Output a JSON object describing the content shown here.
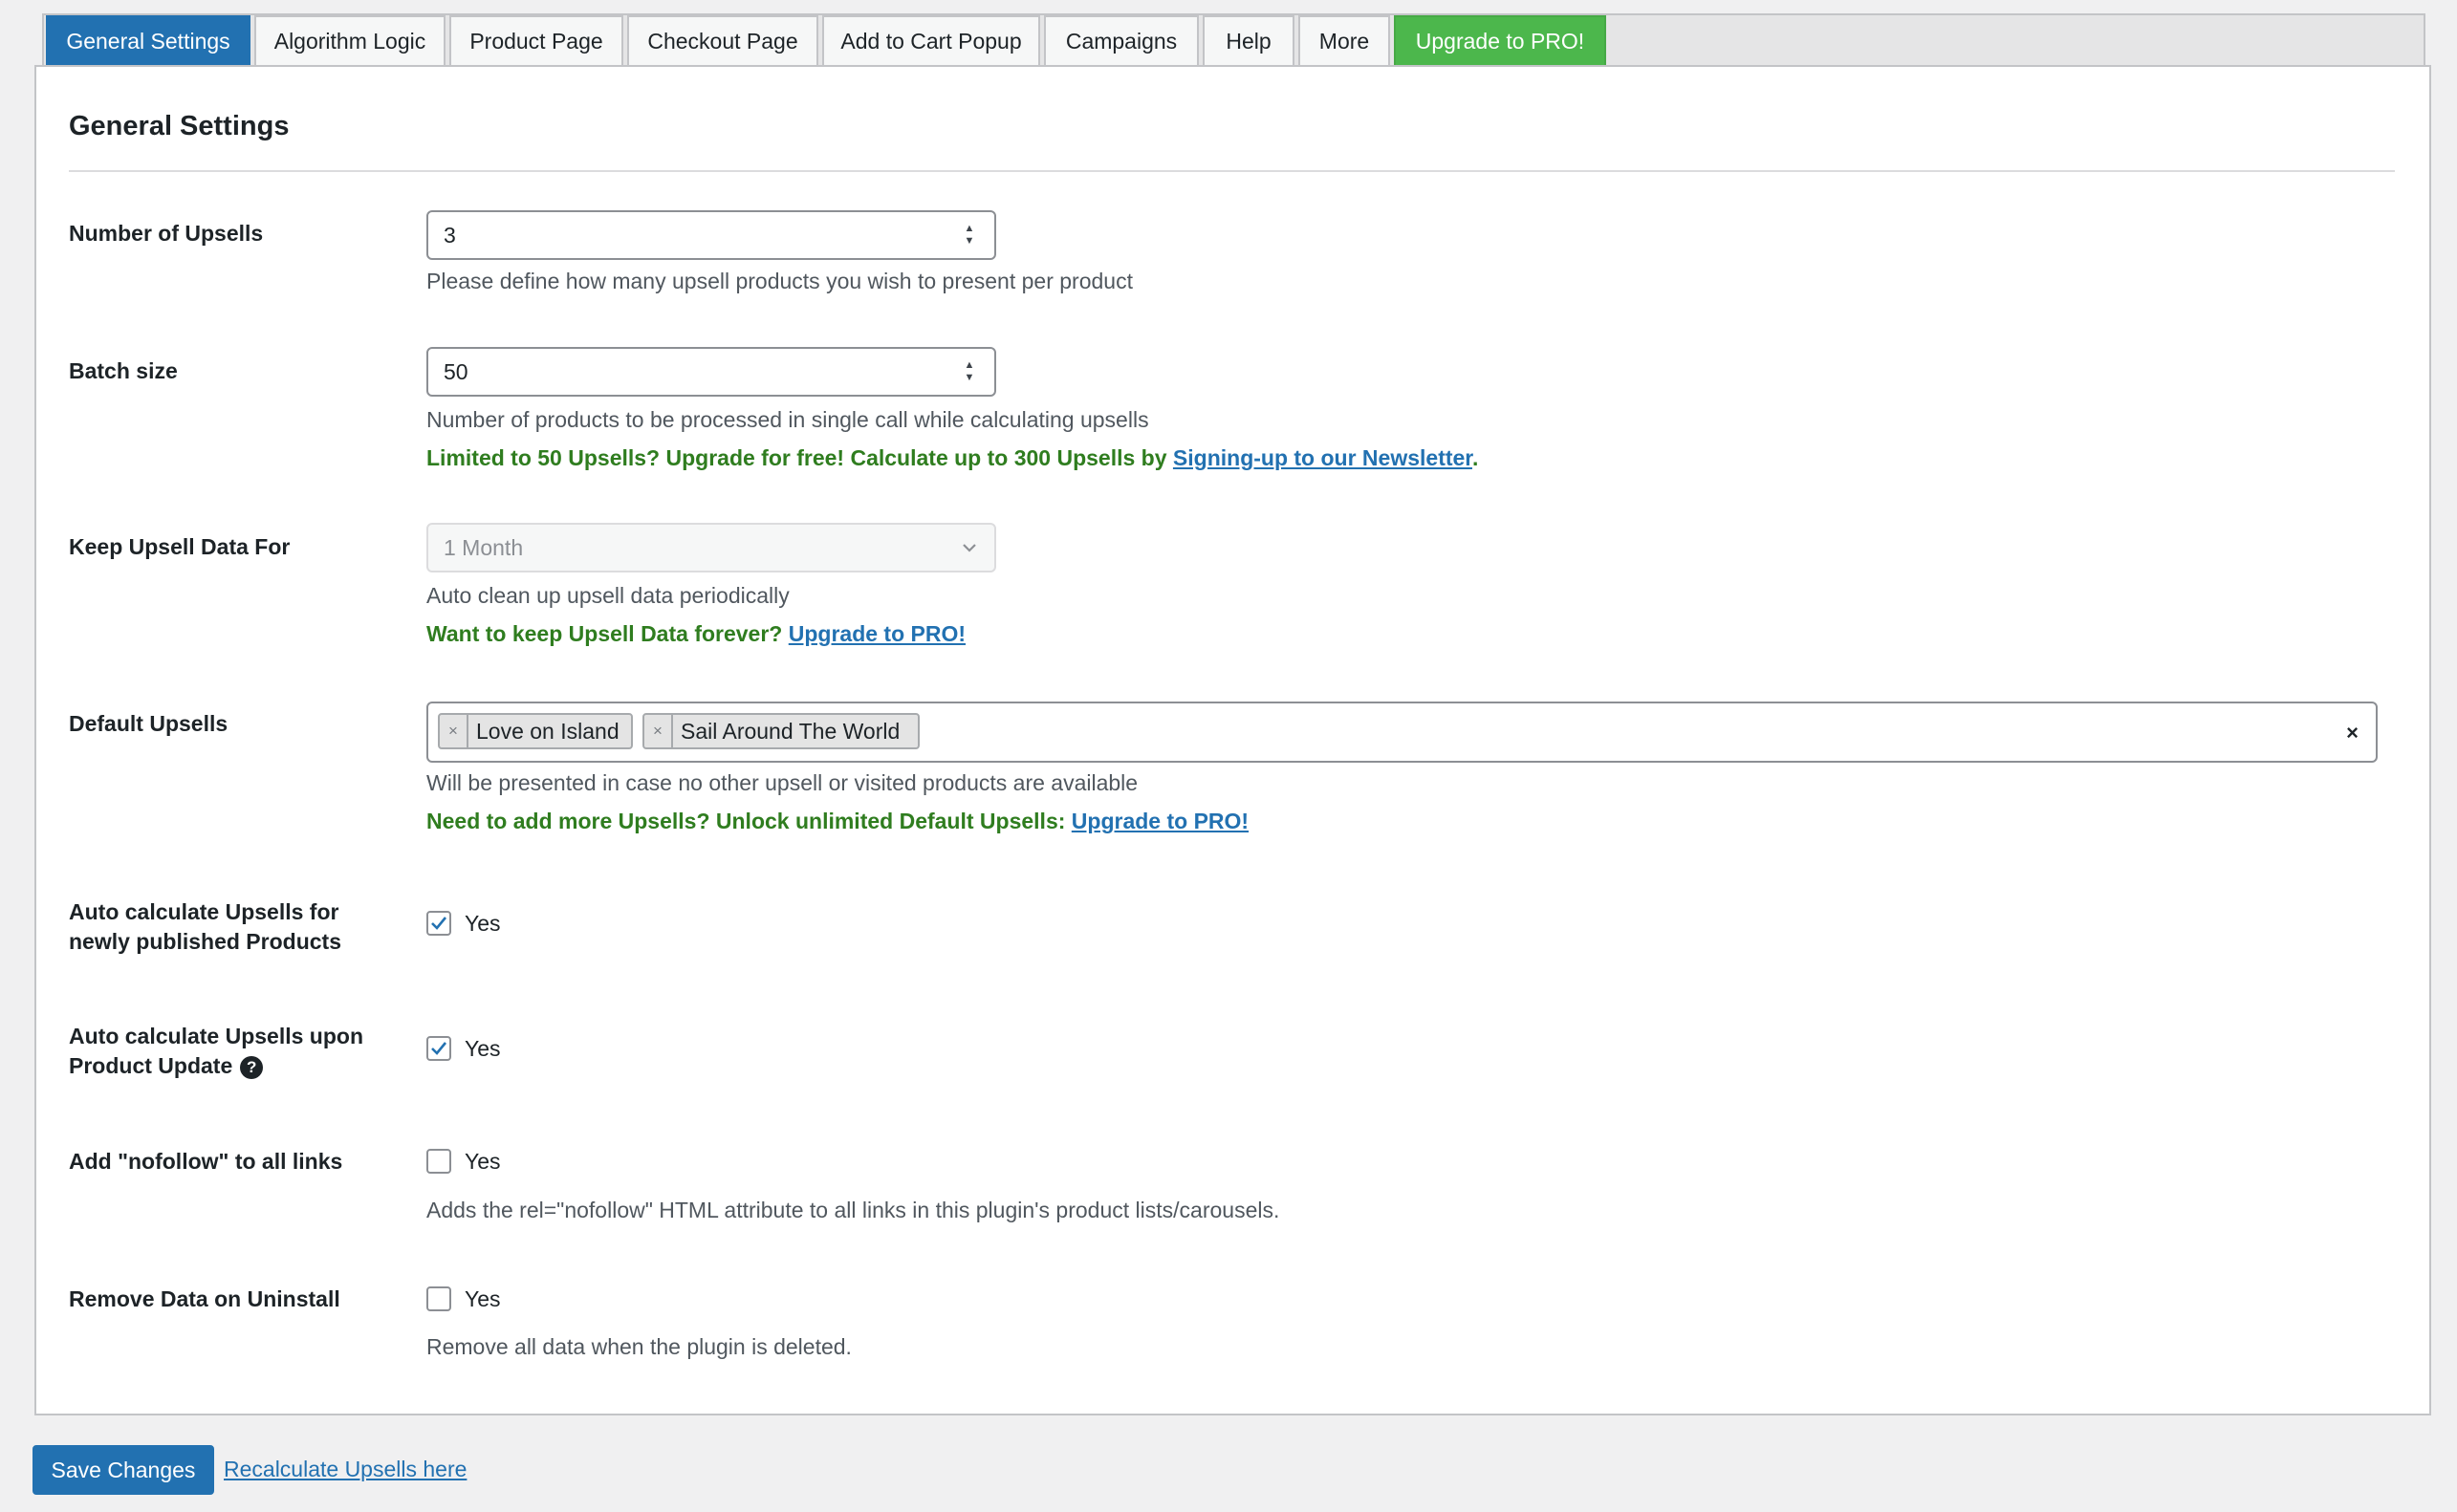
{
  "tabs": [
    {
      "label": "General Settings",
      "active": true
    },
    {
      "label": "Algorithm Logic"
    },
    {
      "label": "Product Page"
    },
    {
      "label": "Checkout Page"
    },
    {
      "label": "Add to Cart Popup"
    },
    {
      "label": "Campaigns"
    },
    {
      "label": "Help"
    },
    {
      "label": "More"
    },
    {
      "label": "Upgrade to PRO!",
      "highlight": true
    }
  ],
  "section_title": "General Settings",
  "fields": {
    "num_upsells": {
      "label": "Number of Upsells",
      "value": "3",
      "desc": "Please define how many upsell products you wish to present per product"
    },
    "batch_size": {
      "label": "Batch size",
      "value": "50",
      "desc": "Number of products to be processed in single call while calculating upsells",
      "promo_text": "Limited to 50 Upsells? Upgrade for free! Calculate up to 300 Upsells by ",
      "promo_link": "Signing-up to our Newsletter",
      "promo_suffix": "."
    },
    "keep_data": {
      "label": "Keep Upsell Data For",
      "value": "1 Month",
      "desc": "Auto clean up upsell data periodically",
      "promo_text": "Want to keep Upsell Data forever? ",
      "promo_link": "Upgrade to PRO!"
    },
    "default_upsells": {
      "label": "Default Upsells",
      "tokens": [
        "Love on Island",
        "Sail Around The World"
      ],
      "clear_symbol": "×",
      "token_remove_symbol": "×",
      "desc": "Will be presented in case no other upsell or visited products are available",
      "promo_text": "Need to add more Upsells? Unlock unlimited Default Upsells: ",
      "promo_link": "Upgrade to PRO!"
    },
    "auto_new": {
      "label_line1": "Auto calculate Upsells for",
      "label_line2": "newly published Products",
      "checked": true,
      "option": "Yes"
    },
    "auto_update": {
      "label_line1": "Auto calculate Upsells upon",
      "label_line2": "Product Update",
      "help_symbol": "?",
      "checked": true,
      "option": "Yes"
    },
    "nofollow": {
      "label": "Add \"nofollow\" to all links",
      "checked": false,
      "option": "Yes",
      "desc": "Adds the rel=\"nofollow\" HTML attribute to all links in this plugin's product lists/carousels."
    },
    "remove_data": {
      "label": "Remove Data on Uninstall",
      "checked": false,
      "option": "Yes",
      "desc": "Remove all data when the plugin is deleted."
    }
  },
  "footer": {
    "save_label": "Save Changes",
    "recalc_label": "Recalculate Upsells here"
  },
  "colors": {
    "primary": "#2271b1",
    "pro_green": "#4cb74c",
    "promo_green": "#2f7d1f"
  }
}
